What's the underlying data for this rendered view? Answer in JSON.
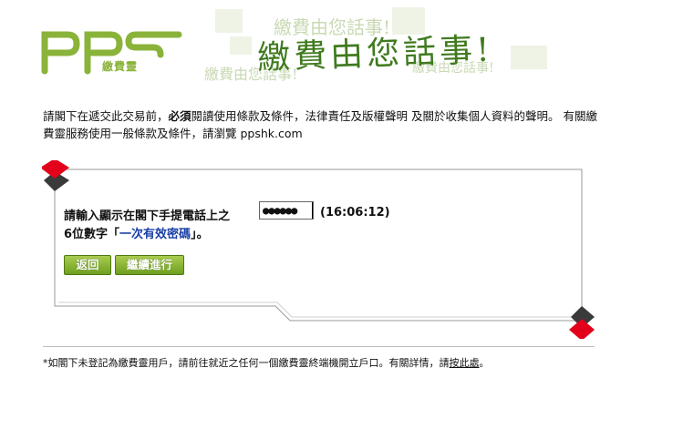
{
  "header": {
    "logo_text": "pps",
    "logo_subtitle": "繳費靈",
    "slogan": "繳費由您話事!",
    "slogan_faded_1": "繳費由您話事!",
    "slogan_faded_2": "繳費由您話事!",
    "slogan_faded_3": "繳費由您話事!"
  },
  "notice": {
    "part1": "請閣下在遞交此交易前，",
    "bold": "必須",
    "part2": "閱讀使用條款及條件，法律責任及版權聲明 及關於收集個人資料的聲明。 有關繳費靈服務使用一般條款及條件，請瀏覽 ppshk.com"
  },
  "otp": {
    "label_line1": "請輸入顯示在閣下手提電話上之",
    "label_line2_prefix": "6位數字「",
    "label_link": "一次有效密碼",
    "label_line2_suffix": "」。",
    "input_value": "●●●●●●",
    "timer": "(16:06:12)"
  },
  "buttons": {
    "back": "返回",
    "continue": "繼續進行"
  },
  "footer": {
    "note_prefix": "*如閣下未登記為繳費靈用戶，請前往就近之任何一個繳費靈終端機開立戶口。有關詳情，請",
    "note_link": "按此處",
    "note_suffix": "。"
  },
  "colors": {
    "brand_green": "#8ab33a",
    "button_green": "#6f9f1e",
    "corner_red": "#e3001b",
    "corner_dark": "#3a3a3a",
    "link_blue": "#1a3fa6"
  }
}
